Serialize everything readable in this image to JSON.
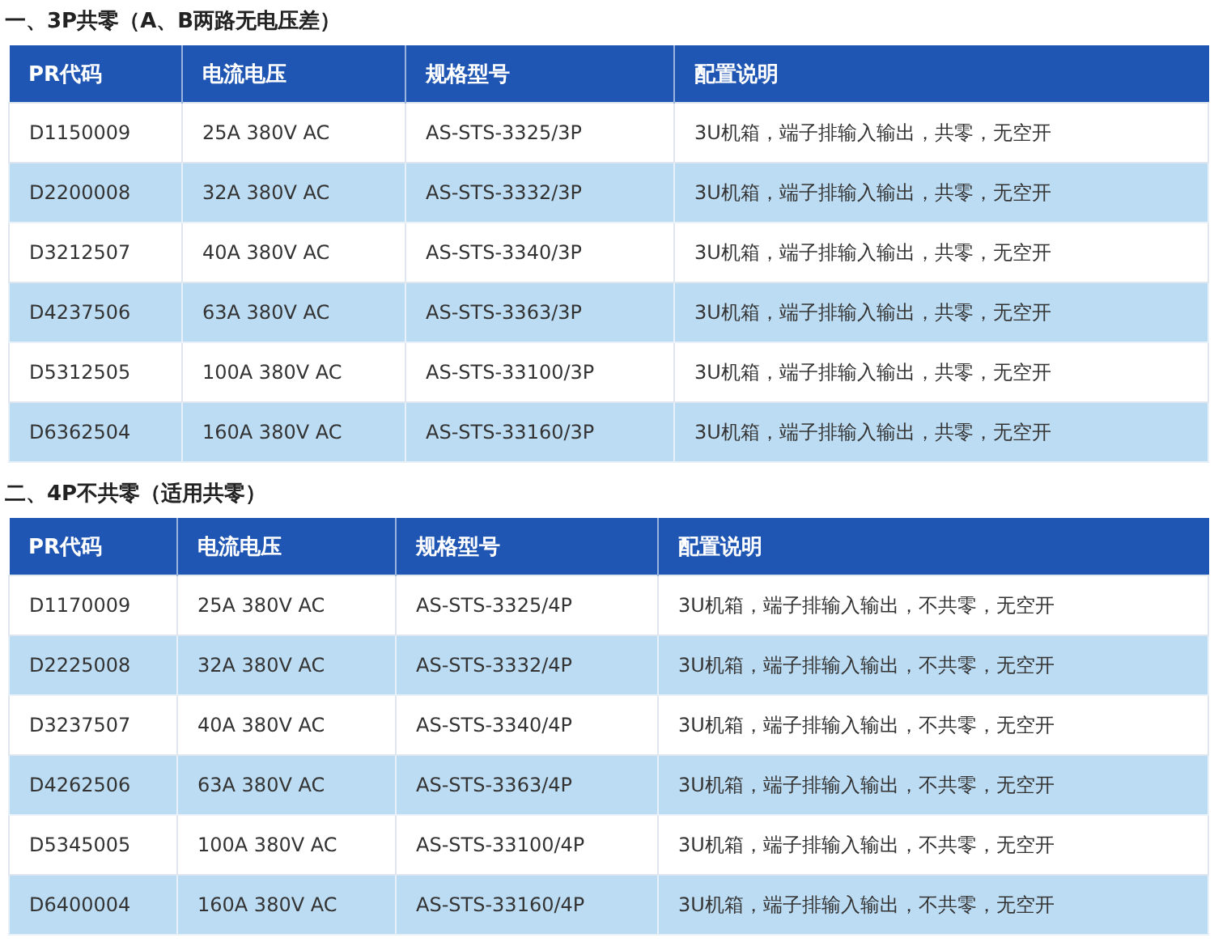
{
  "sections": [
    {
      "title": "一、3P共零（A、B两路无电压差）",
      "columns": [
        "PR代码",
        "电流电压",
        "规格型号",
        "配置说明"
      ],
      "rows": [
        [
          "D1150009",
          "25A 380V AC",
          "AS-STS-3325/3P",
          "3U机箱，端子排输入输出，共零，无空开"
        ],
        [
          "D2200008",
          "32A 380V AC",
          "AS-STS-3332/3P",
          "3U机箱，端子排输入输出，共零，无空开"
        ],
        [
          "D3212507",
          "40A 380V AC",
          "AS-STS-3340/3P",
          "3U机箱，端子排输入输出，共零，无空开"
        ],
        [
          "D4237506",
          "63A 380V AC",
          "AS-STS-3363/3P",
          "3U机箱，端子排输入输出，共零，无空开"
        ],
        [
          "D5312505",
          "100A 380V AC",
          "AS-STS-33100/3P",
          "3U机箱，端子排输入输出，共零，无空开"
        ],
        [
          "D6362504",
          "160A 380V AC",
          "AS-STS-33160/3P",
          "3U机箱，端子排输入输出，共零，无空开"
        ]
      ]
    },
    {
      "title": "二、4P不共零（适用共零）",
      "columns": [
        "PR代码",
        "电流电压",
        "规格型号",
        "配置说明"
      ],
      "rows": [
        [
          "D1170009",
          "25A 380V AC",
          "AS-STS-3325/4P",
          "3U机箱，端子排输入输出，不共零，无空开"
        ],
        [
          "D2225008",
          "32A 380V AC",
          "AS-STS-3332/4P",
          "3U机箱，端子排输入输出，不共零，无空开"
        ],
        [
          "D3237507",
          "40A 380V AC",
          "AS-STS-3340/4P",
          "3U机箱，端子排输入输出，不共零，无空开"
        ],
        [
          "D4262506",
          "63A 380V AC",
          "AS-STS-3363/4P",
          "3U机箱，端子排输入输出，不共零，无空开"
        ],
        [
          "D5345005",
          "100A 380V AC",
          "AS-STS-33100/4P",
          "3U机箱，端子排输入输出，不共零，无空开"
        ],
        [
          "D6400004",
          "160A 380V AC",
          "AS-STS-33160/4P",
          "3U机箱，端子排输入输出，不共零，无空开"
        ]
      ]
    }
  ]
}
